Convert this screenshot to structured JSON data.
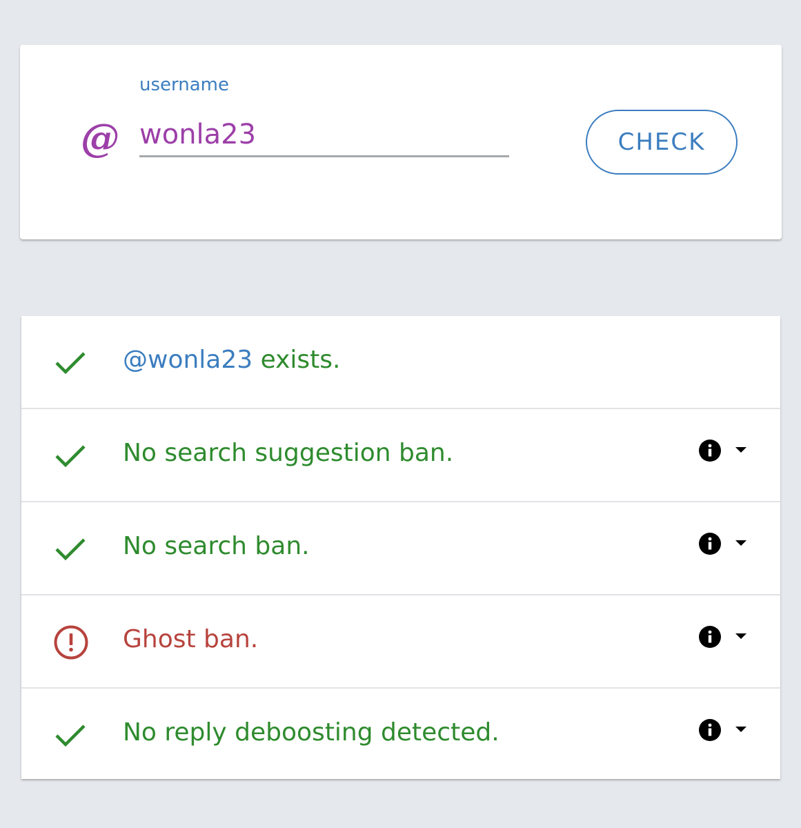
{
  "search": {
    "at_symbol": "@",
    "label": "username",
    "value": "wonla23",
    "button_label": "CHECK"
  },
  "results": [
    {
      "status": "ok",
      "icon": "check-icon",
      "handle": "@wonla23",
      "text": " exists.",
      "has_info": false
    },
    {
      "status": "ok",
      "icon": "check-icon",
      "text": "No search suggestion ban.",
      "has_info": true
    },
    {
      "status": "ok",
      "icon": "check-icon",
      "text": "No search ban.",
      "has_info": true
    },
    {
      "status": "bad",
      "icon": "error-icon",
      "text": "Ghost ban.",
      "has_info": true
    },
    {
      "status": "ok",
      "icon": "check-icon",
      "text": "No reply deboosting detected.",
      "has_info": true
    }
  ],
  "colors": {
    "ok": "#2e8b2e",
    "bad": "#b7433d",
    "accent": "#3b7dbf",
    "username": "#9c3fa8",
    "background": "#e5e8ed"
  }
}
